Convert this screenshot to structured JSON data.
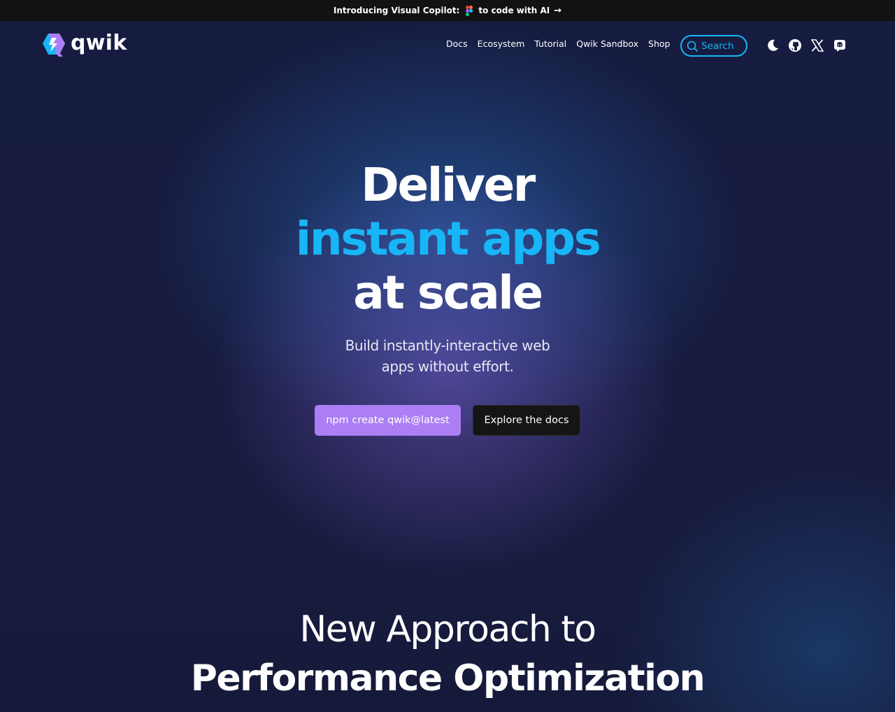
{
  "announcement": {
    "prefix": "Introducing Visual Copilot:",
    "suffix": "to code with AI",
    "figma_icon": "figma-icon",
    "arrow_icon": "arrow-right-icon"
  },
  "header": {
    "logo_text": "qwik",
    "logo_icon": "qwik-logo-icon",
    "nav": [
      {
        "label": "Docs"
      },
      {
        "label": "Ecosystem"
      },
      {
        "label": "Tutorial"
      },
      {
        "label": "Qwik Sandbox"
      },
      {
        "label": "Shop"
      }
    ],
    "search_label": "Search",
    "icons": [
      "moon-icon",
      "github-icon",
      "x-icon",
      "discord-icon"
    ]
  },
  "hero": {
    "line1": "Deliver",
    "line2": "instant apps",
    "line3": "at scale",
    "sub_line1": "Build instantly-interactive web",
    "sub_line2": "apps without effort.",
    "primary_cta": "npm create qwik@latest",
    "secondary_cta": "Explore the docs"
  },
  "section": {
    "line1": "New Approach to",
    "line2": "Performance Optimization"
  },
  "colors": {
    "accent_blue": "#18b6f6",
    "accent_purple": "#ac7ef4",
    "background": "#161c40",
    "bar": "#121212"
  }
}
